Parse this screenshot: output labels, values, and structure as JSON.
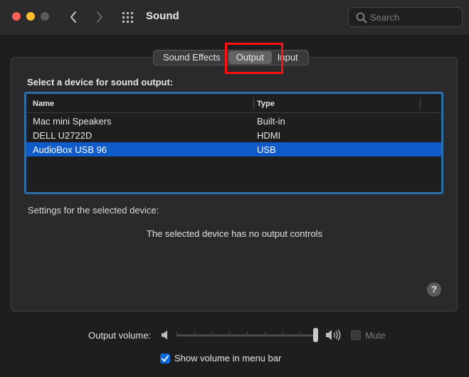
{
  "window": {
    "title": "Sound"
  },
  "search": {
    "placeholder": "Search"
  },
  "tabs": [
    {
      "label": "Sound Effects",
      "selected": false
    },
    {
      "label": "Output",
      "selected": true
    },
    {
      "label": "Input",
      "selected": false
    }
  ],
  "output": {
    "section_label": "Select a device for sound output:",
    "columns": {
      "name": "Name",
      "type": "Type"
    },
    "devices": [
      {
        "name": "Mac mini Speakers",
        "type": "Built-in",
        "selected": false
      },
      {
        "name": "DELL U2722D",
        "type": "HDMI",
        "selected": false
      },
      {
        "name": "AudioBox USB 96",
        "type": "USB",
        "selected": true
      }
    ],
    "settings_label": "Settings for the selected device:",
    "no_controls_text": "The selected device has no output controls"
  },
  "help": {
    "label": "?"
  },
  "volume": {
    "label": "Output volume:",
    "level": 1.0,
    "mute_label": "Mute",
    "mute_checked": false,
    "mute_enabled": false
  },
  "menu_bar_option": {
    "label": "Show volume in menu bar",
    "checked": true
  },
  "colors": {
    "accent": "#0f5bc9",
    "highlight_box": "#ff1111",
    "table_focus_ring": "#2b6ea8",
    "traffic_close": "#ff5f57",
    "traffic_minimize": "#febc2e"
  },
  "icons": [
    "close-window",
    "minimize-window",
    "zoom-window",
    "chevron-left",
    "chevron-right",
    "grid",
    "magnifying-glass",
    "speaker-low",
    "speaker-high",
    "checkmark",
    "question-mark"
  ]
}
